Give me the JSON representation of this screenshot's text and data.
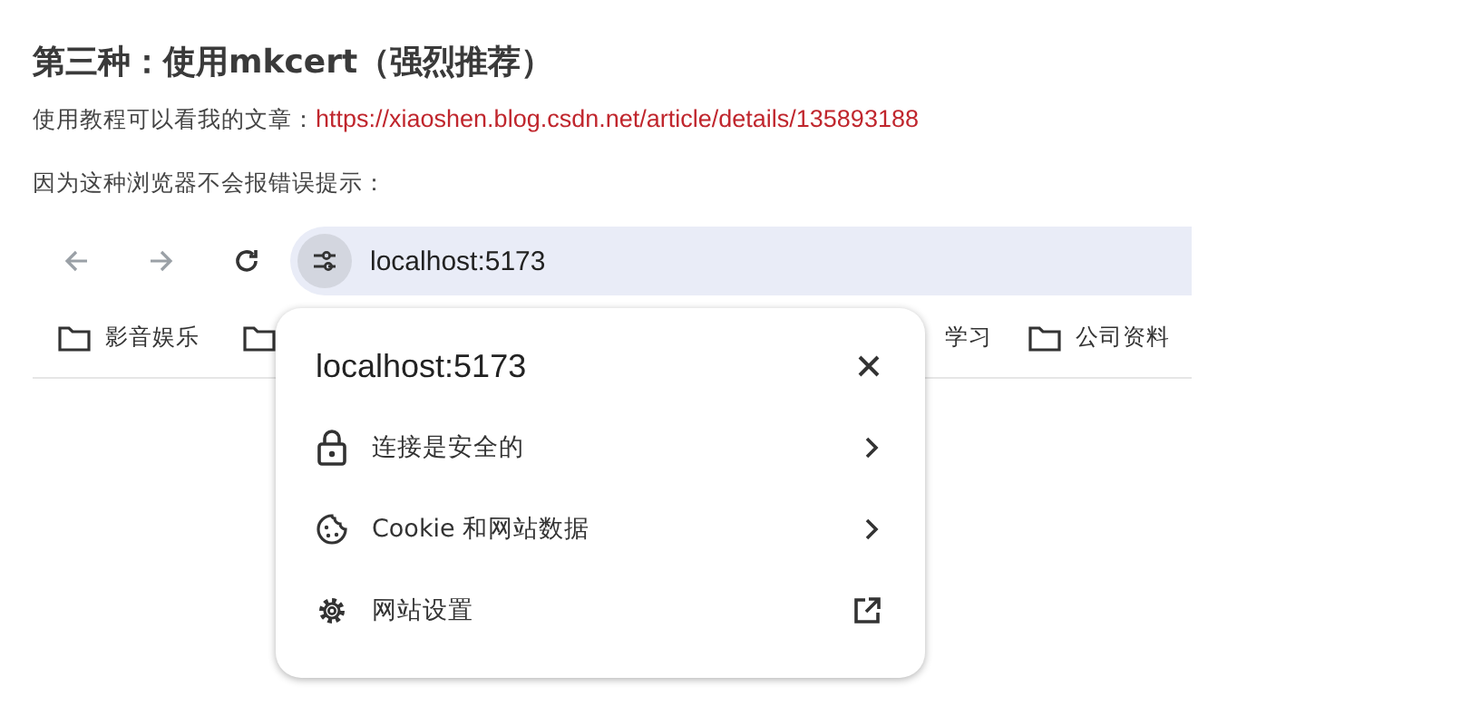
{
  "heading": "第三种：使用mkcert（强烈推荐）",
  "tutorial": {
    "text": "使用教程可以看我的文章：",
    "link": "https://xiaoshen.blog.csdn.net/article/details/135893188"
  },
  "note": "因为这种浏览器不会报错误提示：",
  "browser": {
    "address": "localhost:5173",
    "bookmarks": [
      {
        "label": "影音娱乐",
        "folder_icon": true
      },
      {
        "folder_icon": true
      },
      {
        "label": "学习",
        "folder_icon": false
      },
      {
        "label": "公司资料",
        "folder_icon": true
      }
    ],
    "popup": {
      "title": "localhost:5173",
      "items": [
        {
          "kind": "lock",
          "label": "连接是安全的"
        },
        {
          "kind": "cookie",
          "label": "Cookie 和网站数据"
        },
        {
          "kind": "gear",
          "label": "网站设置"
        }
      ]
    }
  }
}
